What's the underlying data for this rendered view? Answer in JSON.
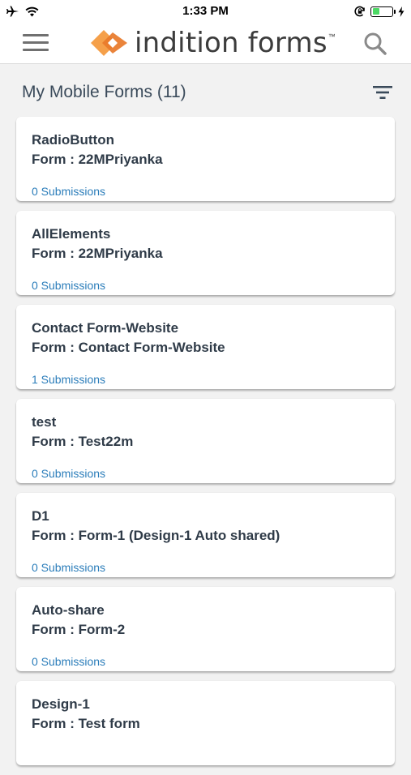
{
  "status_bar": {
    "time": "1:33 PM"
  },
  "header": {
    "brand_name": "indition forms",
    "brand_tm": "™",
    "logo_colors": [
      "#f5a04a",
      "#e8792a"
    ]
  },
  "list": {
    "title": "My Mobile Forms (11)"
  },
  "forms": [
    {
      "name": "RadioButton",
      "form": "Form : 22MPriyanka",
      "submissions": "0 Submissions"
    },
    {
      "name": "AllElements",
      "form": "Form : 22MPriyanka",
      "submissions": "0 Submissions"
    },
    {
      "name": "Contact Form-Website",
      "form": "Form : Contact Form-Website",
      "submissions": "1 Submissions"
    },
    {
      "name": "test",
      "form": "Form : Test22m",
      "submissions": "0 Submissions"
    },
    {
      "name": "D1",
      "form": "Form : Form-1 (Design-1 Auto shared)",
      "submissions": "0 Submissions"
    },
    {
      "name": "Auto-share",
      "form": "Form : Form-2",
      "submissions": "0 Submissions"
    },
    {
      "name": "Design-1",
      "form": "Form : Test form",
      "submissions": ""
    }
  ],
  "colors": {
    "accent_link": "#2b7dba",
    "battery_fill": "#4cd964",
    "text_dark": "#2f3b48"
  }
}
